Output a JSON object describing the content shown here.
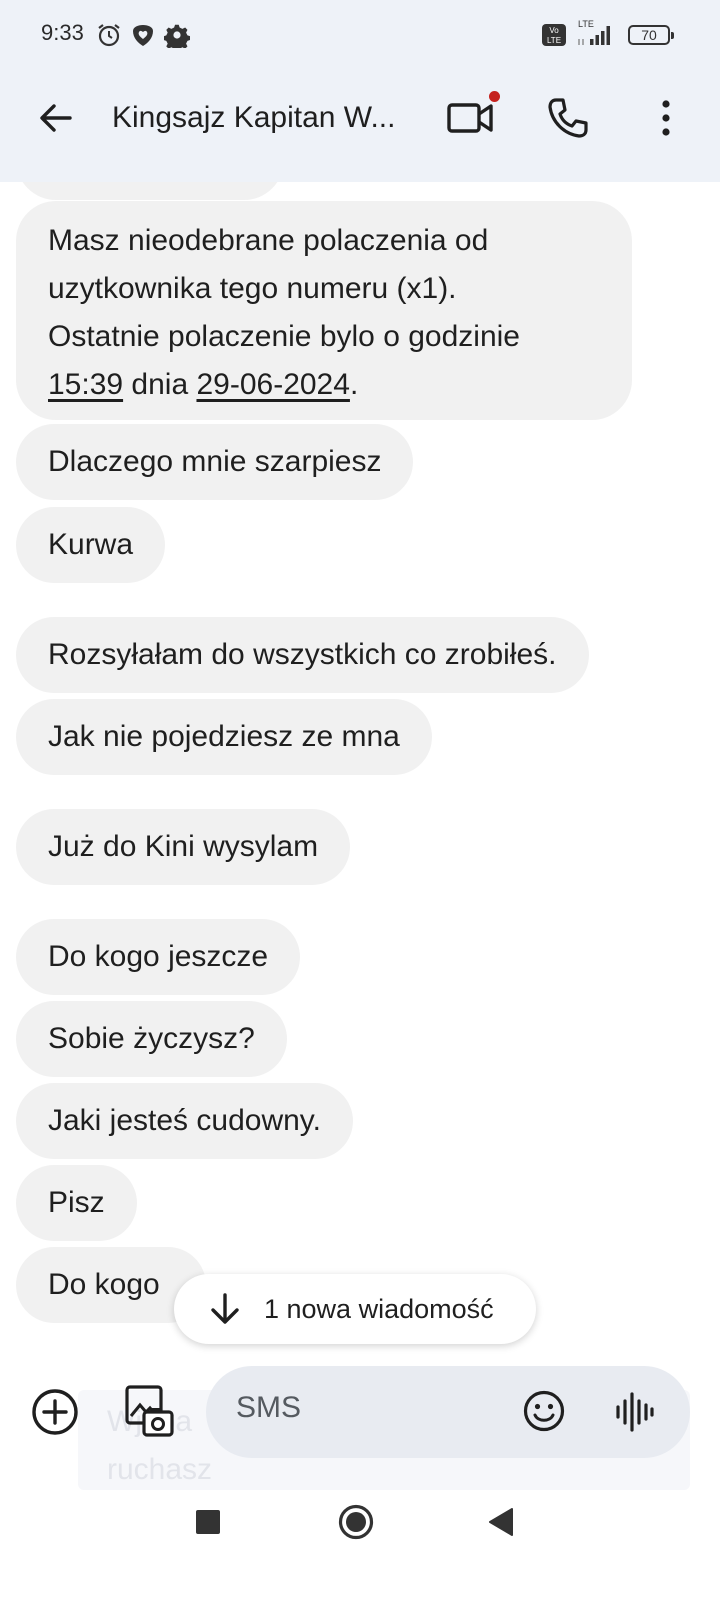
{
  "status_bar": {
    "time": "9:33",
    "battery": "70",
    "icons": [
      "alarm-icon",
      "heart-shield-icon",
      "gear-icon",
      "volte-icon",
      "lte-signal-icon",
      "battery-icon"
    ]
  },
  "header": {
    "title": "Kingsajz Kapitan W...",
    "actions": [
      "back-arrow-icon",
      "video-call-icon",
      "phone-icon",
      "more-vert-icon"
    ],
    "video_badge_color": "#c5221f"
  },
  "messages": {
    "m1": {
      "line1": "Masz nieodebrane polaczenia od",
      "line2": "uzytkownika tego numeru (x1).",
      "line3": "Ostatnie polaczenie bylo o godzinie",
      "time": "15:39",
      "mid": " dnia ",
      "date": "29-06-2024",
      "end": "."
    },
    "m2": "Dlaczego mnie szarpiesz",
    "m3": "Kurwa",
    "m4": "Rozsyłałam do wszystkich co zrobiłeś.",
    "m5": "Jak nie pojedziesz ze mna",
    "m6": "Już do Kini wysylam",
    "m7": "Do kogo jeszcze",
    "m8": "Sobie życzysz?",
    "m9": "Jaki jesteś cudowny.",
    "m10": "Pisz",
    "m11": "Do kogo"
  },
  "new_message_pill": {
    "label": "1 nowa wiadomość"
  },
  "compose": {
    "placeholder": "SMS",
    "ghost_line1": "Wjeba",
    "ghost_line2": "ruchasz"
  },
  "colors": {
    "header_bg": "#eef2f8",
    "bubble_bg": "#f1f1f1",
    "compose_bg": "#e8ebf1"
  }
}
